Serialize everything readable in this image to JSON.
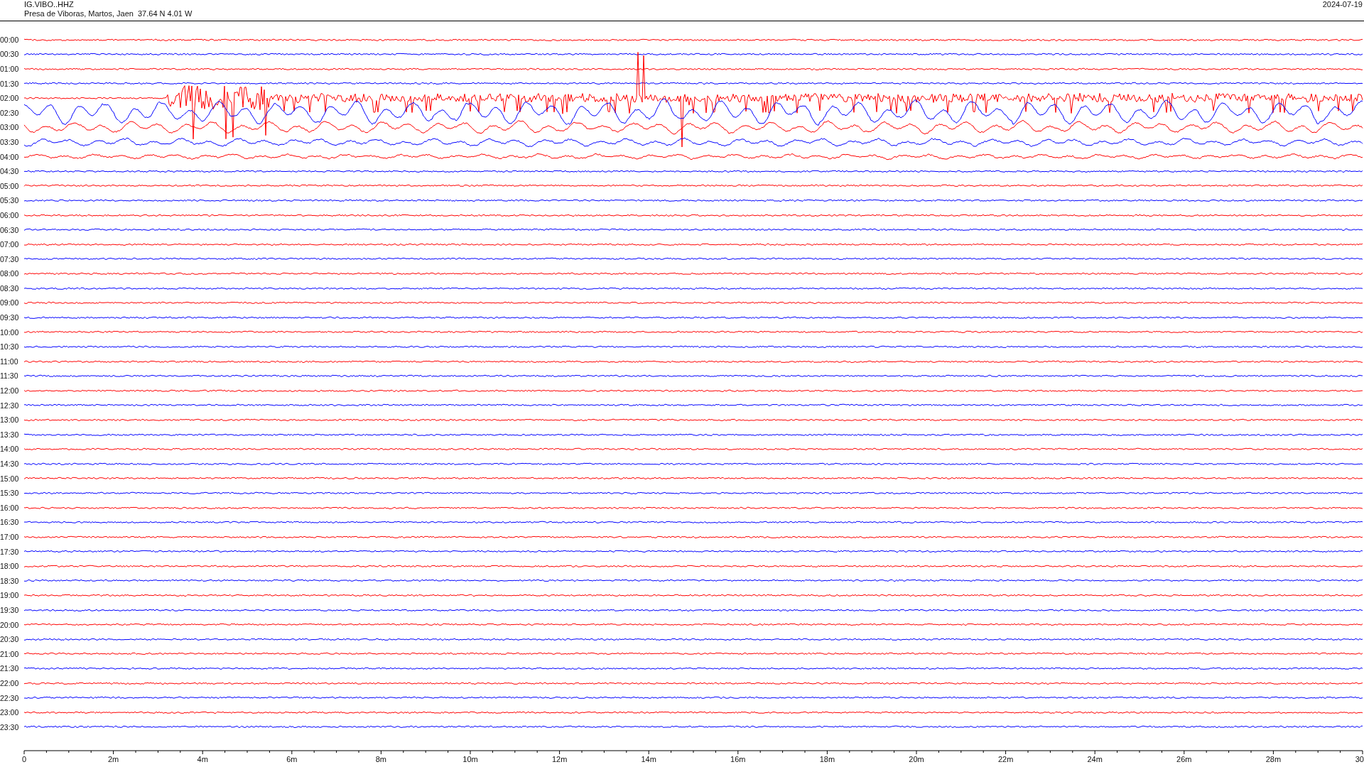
{
  "header": {
    "station": "IG.VIBO..HHZ",
    "location": "Presa de Viboras, Martos, Jaen  37.64 N 4.01 W",
    "date": "2024-07-19"
  },
  "traces": [
    {
      "time": "00:00",
      "color": "#ff0000",
      "kind": "noise"
    },
    {
      "time": "00:30",
      "color": "#0000ff",
      "kind": "noise"
    },
    {
      "time": "01:00",
      "color": "#ff0000",
      "kind": "noise"
    },
    {
      "time": "01:30",
      "color": "#0000ff",
      "kind": "noise"
    },
    {
      "time": "02:00",
      "color": "#ff0000",
      "kind": "burst"
    },
    {
      "time": "02:30",
      "color": "#0000ff",
      "kind": "swell"
    },
    {
      "time": "03:00",
      "color": "#ff0000",
      "kind": "swell"
    },
    {
      "time": "03:30",
      "color": "#0000ff",
      "kind": "swell"
    },
    {
      "time": "04:00",
      "color": "#ff0000",
      "kind": "swell"
    },
    {
      "time": "04:30",
      "color": "#0000ff",
      "kind": "noise"
    },
    {
      "time": "05:00",
      "color": "#ff0000",
      "kind": "noise"
    },
    {
      "time": "05:30",
      "color": "#0000ff",
      "kind": "noise"
    },
    {
      "time": "06:00",
      "color": "#ff0000",
      "kind": "noise"
    },
    {
      "time": "06:30",
      "color": "#0000ff",
      "kind": "noise"
    },
    {
      "time": "07:00",
      "color": "#ff0000",
      "kind": "noise"
    },
    {
      "time": "07:30",
      "color": "#0000ff",
      "kind": "noise"
    },
    {
      "time": "08:00",
      "color": "#ff0000",
      "kind": "noise"
    },
    {
      "time": "08:30",
      "color": "#0000ff",
      "kind": "noise"
    },
    {
      "time": "09:00",
      "color": "#ff0000",
      "kind": "noise"
    },
    {
      "time": "09:30",
      "color": "#0000ff",
      "kind": "noise"
    },
    {
      "time": "10:00",
      "color": "#ff0000",
      "kind": "noise"
    },
    {
      "time": "10:30",
      "color": "#0000ff",
      "kind": "noise"
    },
    {
      "time": "11:00",
      "color": "#ff0000",
      "kind": "noise"
    },
    {
      "time": "11:30",
      "color": "#0000ff",
      "kind": "noise"
    },
    {
      "time": "12:00",
      "color": "#ff0000",
      "kind": "noise"
    },
    {
      "time": "12:30",
      "color": "#0000ff",
      "kind": "noise"
    },
    {
      "time": "13:00",
      "color": "#ff0000",
      "kind": "noise"
    },
    {
      "time": "13:30",
      "color": "#0000ff",
      "kind": "noise"
    },
    {
      "time": "14:00",
      "color": "#ff0000",
      "kind": "noise"
    },
    {
      "time": "14:30",
      "color": "#0000ff",
      "kind": "noise"
    },
    {
      "time": "15:00",
      "color": "#ff0000",
      "kind": "noise"
    },
    {
      "time": "15:30",
      "color": "#0000ff",
      "kind": "noise"
    },
    {
      "time": "16:00",
      "color": "#ff0000",
      "kind": "noise"
    },
    {
      "time": "16:30",
      "color": "#0000ff",
      "kind": "noise"
    },
    {
      "time": "17:00",
      "color": "#ff0000",
      "kind": "noise"
    },
    {
      "time": "17:30",
      "color": "#0000ff",
      "kind": "noise"
    },
    {
      "time": "18:00",
      "color": "#ff0000",
      "kind": "noise"
    },
    {
      "time": "18:30",
      "color": "#0000ff",
      "kind": "noise"
    },
    {
      "time": "19:00",
      "color": "#ff0000",
      "kind": "noise"
    },
    {
      "time": "19:30",
      "color": "#0000ff",
      "kind": "noise"
    },
    {
      "time": "20:00",
      "color": "#ff0000",
      "kind": "noise"
    },
    {
      "time": "20:30",
      "color": "#0000ff",
      "kind": "noise"
    },
    {
      "time": "21:00",
      "color": "#ff0000",
      "kind": "noise"
    },
    {
      "time": "21:30",
      "color": "#0000ff",
      "kind": "noise"
    },
    {
      "time": "22:00",
      "color": "#ff0000",
      "kind": "noise"
    },
    {
      "time": "22:30",
      "color": "#0000ff",
      "kind": "noise"
    },
    {
      "time": "23:00",
      "color": "#ff0000",
      "kind": "noise"
    },
    {
      "time": "23:30",
      "color": "#0000ff",
      "kind": "noise"
    }
  ],
  "axis": {
    "labels": [
      "0",
      "2m",
      "4m",
      "6m",
      "8m",
      "10m",
      "12m",
      "14m",
      "16m",
      "18m",
      "20m",
      "22m",
      "24m",
      "26m",
      "28m",
      "30"
    ]
  }
}
